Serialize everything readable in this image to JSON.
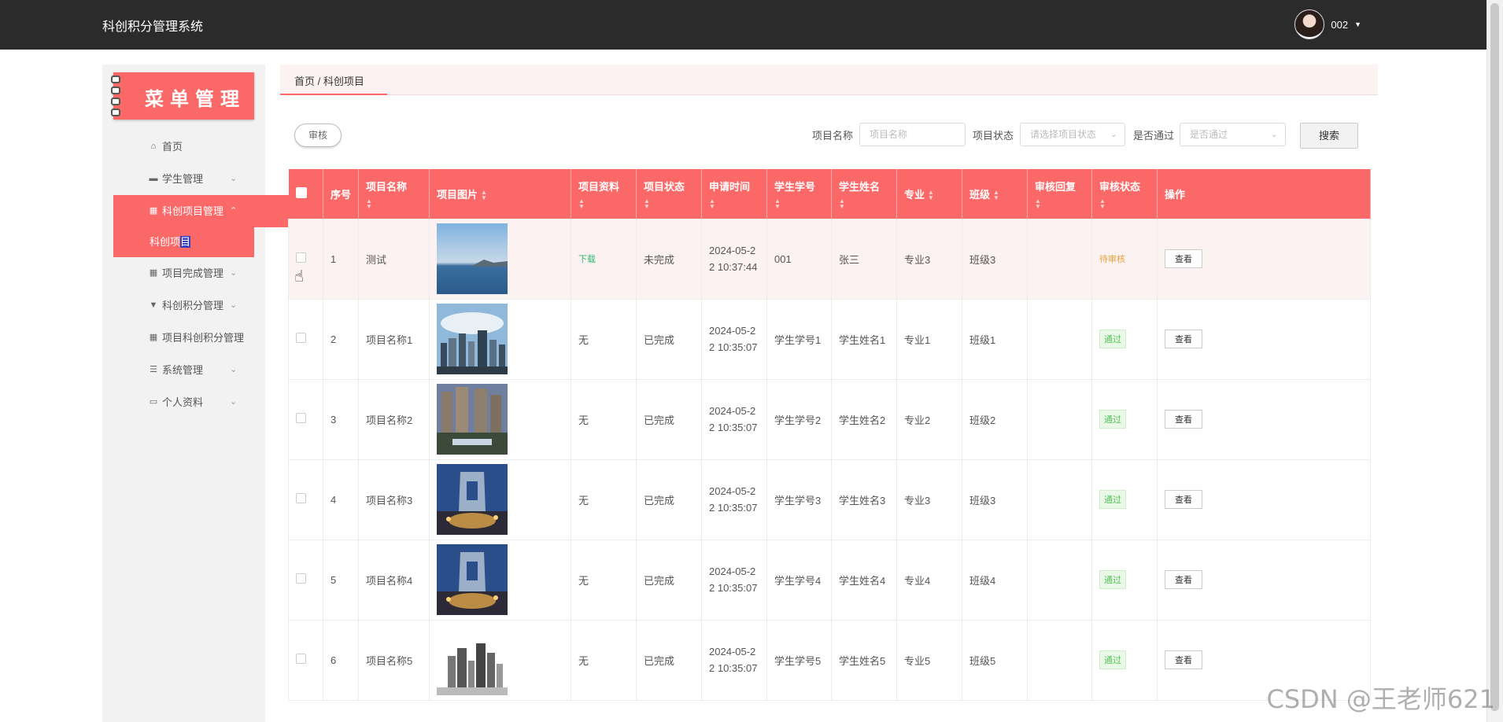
{
  "app": {
    "title": "科创积分管理系统"
  },
  "user": {
    "name": "002"
  },
  "menu": {
    "banner": "菜单管理",
    "items": [
      {
        "label": "首页",
        "icon": "home-icon",
        "active": false,
        "expandable": false
      },
      {
        "label": "学生管理",
        "icon": "briefcase-icon",
        "active": false,
        "expandable": true
      },
      {
        "label": "科创项目管理",
        "icon": "grid-icon",
        "active": true,
        "expandable": true
      },
      {
        "label": "项目完成管理",
        "icon": "grid-icon",
        "active": false,
        "expandable": true
      },
      {
        "label": "科创积分管理",
        "icon": "pin-icon",
        "active": false,
        "expandable": true
      },
      {
        "label": "项目科创积分管理",
        "icon": "grid-icon",
        "active": false,
        "expandable": false
      },
      {
        "label": "系统管理",
        "icon": "list-icon",
        "active": false,
        "expandable": true
      },
      {
        "label": "个人资料",
        "icon": "card-icon",
        "active": false,
        "expandable": true
      }
    ],
    "sub_item": {
      "prefix": "科创项",
      "selected": "目"
    }
  },
  "breadcrumb": "首页 / 科创项目",
  "toolbar": {
    "audit_label": "审核",
    "filters": {
      "name_label": "项目名称",
      "name_placeholder": "项目名称",
      "status_label": "项目状态",
      "status_placeholder": "请选择项目状态",
      "pass_label": "是否通过",
      "pass_placeholder": "是否通过"
    },
    "search_label": "搜索"
  },
  "table": {
    "headers": {
      "index": "序号",
      "name": "项目名称",
      "image": "项目图片",
      "material": "项目资料",
      "status": "项目状态",
      "apply_time": "申请时间",
      "student_no": "学生学号",
      "student_name": "学生姓名",
      "major": "专业",
      "class": "班级",
      "reply": "审核回复",
      "audit_status": "审核状态",
      "actions": "操作"
    },
    "rows": [
      {
        "index": "1",
        "name": "测试",
        "image": "coast",
        "material": "下载",
        "status": "未完成",
        "time1": "2024-05-2",
        "time2": "2 10:37:44",
        "student_no": "001",
        "student_name": "张三",
        "major": "专业3",
        "class": "班级3",
        "reply": "",
        "audit": "待审核",
        "action": "查看"
      },
      {
        "index": "2",
        "name": "项目名称1",
        "image": "city",
        "material": "无",
        "status": "已完成",
        "time1": "2024-05-2",
        "time2": "2 10:35:07",
        "student_no": "学生学号1",
        "student_name": "学生姓名1",
        "major": "专业1",
        "class": "班级1",
        "reply": "",
        "audit": "通过",
        "action": "查看"
      },
      {
        "index": "3",
        "name": "项目名称2",
        "image": "towers",
        "material": "无",
        "status": "已完成",
        "time1": "2024-05-2",
        "time2": "2 10:35:07",
        "student_no": "学生学号2",
        "student_name": "学生姓名2",
        "major": "专业2",
        "class": "班级2",
        "reply": "",
        "audit": "通过",
        "action": "查看"
      },
      {
        "index": "4",
        "name": "项目名称3",
        "image": "night",
        "material": "无",
        "status": "已完成",
        "time1": "2024-05-2",
        "time2": "2 10:35:07",
        "student_no": "学生学号3",
        "student_name": "学生姓名3",
        "major": "专业3",
        "class": "班级3",
        "reply": "",
        "audit": "通过",
        "action": "查看"
      },
      {
        "index": "5",
        "name": "项目名称4",
        "image": "night",
        "material": "无",
        "status": "已完成",
        "time1": "2024-05-2",
        "time2": "2 10:35:07",
        "student_no": "学生学号4",
        "student_name": "学生姓名4",
        "major": "专业4",
        "class": "班级4",
        "reply": "",
        "audit": "通过",
        "action": "查看"
      },
      {
        "index": "6",
        "name": "项目名称5",
        "image": "sketch",
        "material": "无",
        "status": "已完成",
        "time1": "2024-05-2",
        "time2": "2 10:35:07",
        "student_no": "学生学号5",
        "student_name": "学生姓名5",
        "major": "专业5",
        "class": "班级5",
        "reply": "",
        "audit": "通过",
        "action": "查看"
      }
    ]
  },
  "colors": {
    "accent": "#fb6868",
    "topbar": "#2b2b2b",
    "pass": "#54c256",
    "pending": "#e6a23c",
    "download": "#2eb872"
  },
  "watermark": "CSDN @王老师621"
}
